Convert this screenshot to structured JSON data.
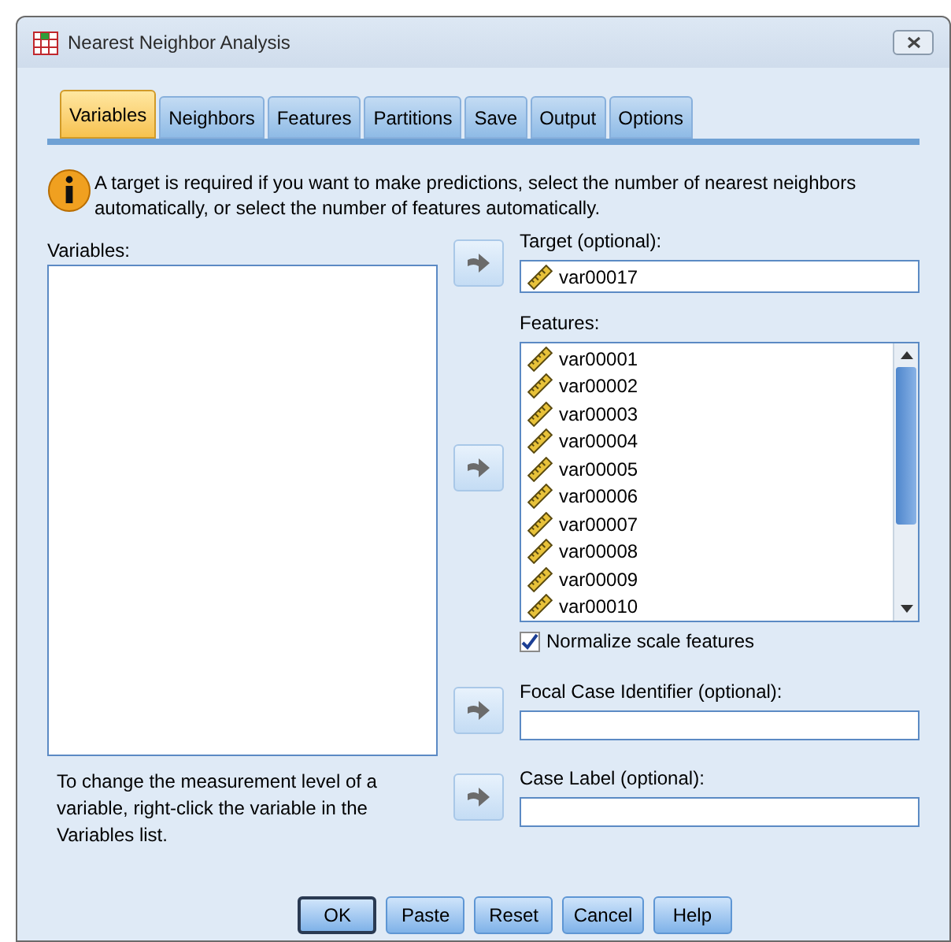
{
  "window": {
    "title": "Nearest Neighbor Analysis"
  },
  "tabs": [
    {
      "label": "Variables",
      "selected": true
    },
    {
      "label": "Neighbors",
      "selected": false
    },
    {
      "label": "Features",
      "selected": false
    },
    {
      "label": "Partitions",
      "selected": false
    },
    {
      "label": "Save",
      "selected": false
    },
    {
      "label": "Output",
      "selected": false
    },
    {
      "label": "Options",
      "selected": false
    }
  ],
  "info": "A target is required if you want to make predictions, select the number of nearest neighbors automatically, or select the number of features automatically.",
  "variables": {
    "label": "Variables:"
  },
  "target": {
    "label": "Target (optional):",
    "value": "var00017"
  },
  "features": {
    "label": "Features:",
    "items": [
      "var00001",
      "var00002",
      "var00003",
      "var00004",
      "var00005",
      "var00006",
      "var00007",
      "var00008",
      "var00009",
      "var00010"
    ]
  },
  "normalize": {
    "label": "Normalize scale features",
    "checked": true
  },
  "focal": {
    "label": "Focal Case Identifier (optional):"
  },
  "case_label": {
    "label": "Case Label (optional):"
  },
  "hint": "To change the measurement level of a variable, right-click the variable in the Variables list.",
  "buttons": [
    {
      "label": "OK",
      "default": true
    },
    {
      "label": "Paste",
      "default": false
    },
    {
      "label": "Reset",
      "default": false
    },
    {
      "label": "Cancel",
      "default": false
    },
    {
      "label": "Help",
      "default": false
    }
  ]
}
